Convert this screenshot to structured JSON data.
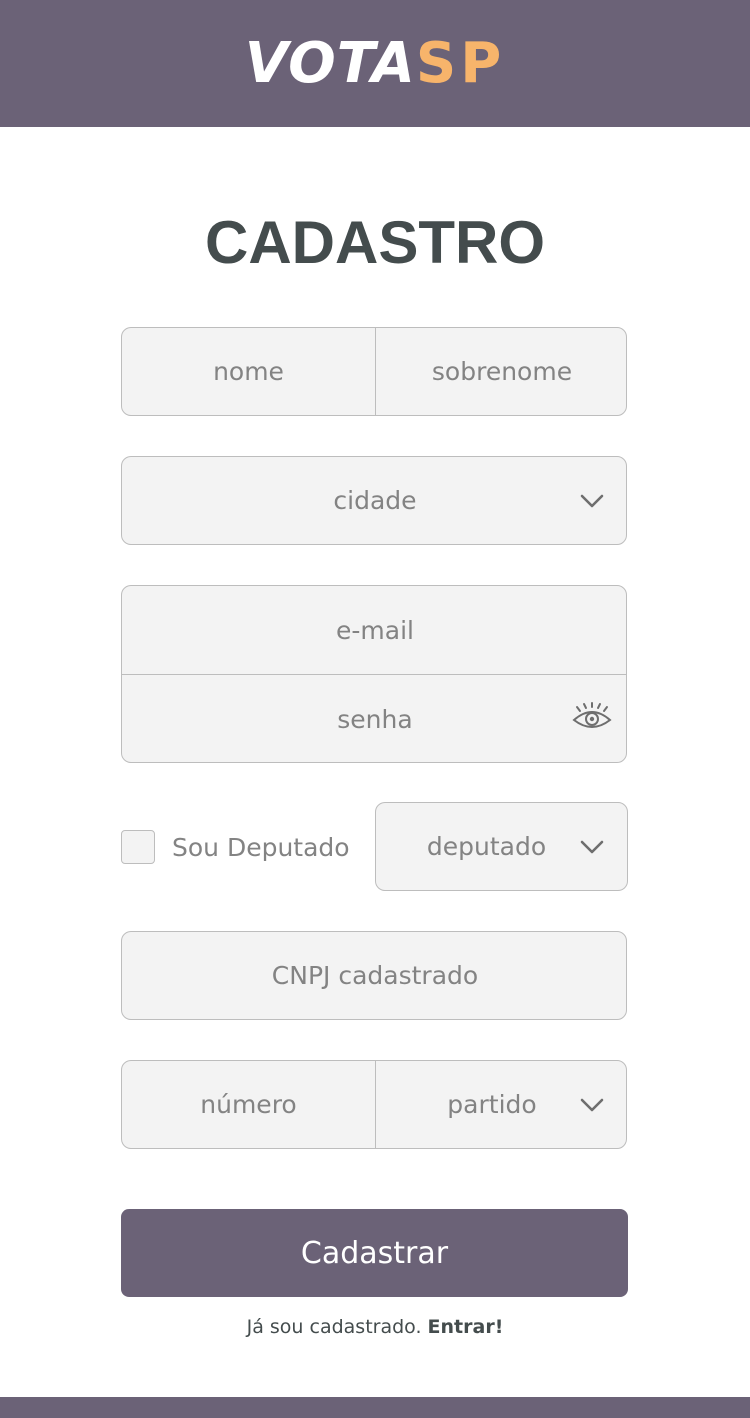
{
  "brand": {
    "logo_part1": "VOTA",
    "logo_part2": "SP",
    "accent_color": "#f7b46b",
    "primary_color": "#6b6277"
  },
  "page": {
    "title": "CADASTRO"
  },
  "form": {
    "nome_placeholder": "nome",
    "sobrenome_placeholder": "sobrenome",
    "cidade_placeholder": "cidade",
    "email_placeholder": "e-mail",
    "senha_placeholder": "senha",
    "deputado_checkbox_label": "Sou Deputado",
    "deputado_select_placeholder": "deputado",
    "cnpj_placeholder": "CNPJ cadastrado",
    "numero_placeholder": "número",
    "partido_placeholder": "partido",
    "submit_label": "Cadastrar"
  },
  "footer_text": {
    "prefix": "Já sou cadastrado.",
    "link": "Entrar!"
  },
  "icons": {
    "dropdown": "chevron-down-icon",
    "password_toggle": "eye-icon"
  }
}
